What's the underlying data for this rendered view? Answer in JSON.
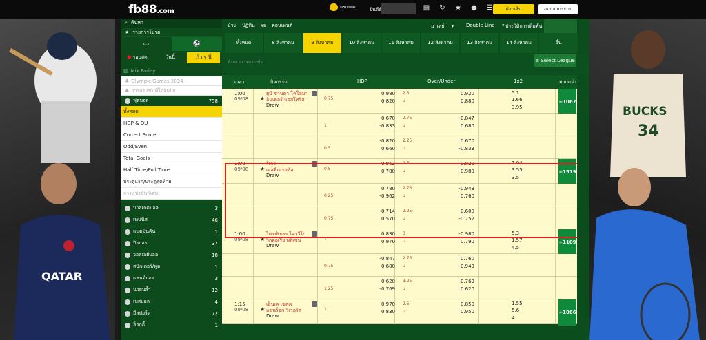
{
  "topbar": {
    "logo": "fb88",
    "logo_suffix": ".com",
    "msg_label": "แชทสด",
    "welcome": "ยินดีต้อนรับ",
    "deposit": "ฝากเงิน",
    "logout": "ออกจากระบบ"
  },
  "sidebar": {
    "search": "ค้นหา",
    "favorites": "รายการโปรด",
    "tabs": [
      "รอบสด",
      "วันนี้",
      "เร็ว ๆ นี้"
    ],
    "mix": "Mix Parlay",
    "olympic1": "Olympic Games 2024",
    "olympic2": "การแข่งขันที่โอลิมปิก",
    "soccer": {
      "label": "ฟุตบอล",
      "count": "758"
    },
    "submenu": [
      "ทั้งหมด",
      "HDP & OU",
      "Correct Score",
      "Odd/Even",
      "Total Goals",
      "Half Time/Full Time",
      "ประตูแรก/ประตูสุดท้าย",
      "การแข่งขันพิเศษ"
    ],
    "sports": [
      {
        "label": "บาสเกตบอล",
        "count": "3"
      },
      {
        "label": "เทนนิส",
        "count": "46"
      },
      {
        "label": "แบดมินตัน",
        "count": "1"
      },
      {
        "label": "ปิงปอง",
        "count": "37"
      },
      {
        "label": "วอลเลย์บอล",
        "count": "18"
      },
      {
        "label": "สนุ๊กเกอร์/พูล",
        "count": "1"
      },
      {
        "label": "แฮนด์บอล",
        "count": "3"
      },
      {
        "label": "นวยปล้ำ",
        "count": "12"
      },
      {
        "label": "เบสบอล",
        "count": "4"
      },
      {
        "label": "อีสปอร์ต",
        "count": "72"
      },
      {
        "label": "ฮ็อกกี้",
        "count": "1"
      }
    ]
  },
  "main": {
    "nav": [
      "บ้าน",
      "ปฏิทิน",
      "ผล",
      "คอนเทนต์"
    ],
    "nav_odds": "มาเลย์",
    "nav_line": "Double Line",
    "nav_history": "ประวัติการเดิมพัน",
    "days": [
      "ทั้งหมด",
      "8 สิงหาคม",
      "9 สิงหาคม",
      "10 สิงหาคม",
      "11 สิงหาคม",
      "12 สิงหาคม",
      "13 สิงหาคม",
      "14 สิงหาคม",
      "อื่น"
    ],
    "section_title": "ค้นหาการแข่งขัน",
    "select_league": "Select League",
    "headers": {
      "time": "เวลา",
      "event": "กิจกรรม",
      "hdp": "HDP",
      "ou": "Over/Under",
      "x12": "1x2",
      "more": "มากกว่า"
    }
  },
  "matches": [
    {
      "time": "1:00",
      "date": "09/08",
      "home": "ยูนี ซานตา โคโลมา",
      "away": "อินเตอร์ แอสโทริส",
      "draw": "Draw",
      "more": "+1067",
      "lines": [
        {
          "hdp": "0.75",
          "hdp_top": "0.980",
          "hdp_bot": "0.820",
          "ou": "2.5",
          "ou_top": "0.920",
          "ou_bot": "0.880",
          "x1": "5.1",
          "x2": "1.66",
          "x3": "3.95"
        },
        {
          "hdp": "1",
          "hdp_top": "0.670",
          "hdp_bot": "-0.833",
          "ou": "2.75",
          "ou_top": "-0.847",
          "ou_bot": "0.680"
        },
        {
          "hdp": "0.5",
          "hdp_top": "-0.820",
          "hdp_bot": "0.660",
          "ou": "2.25",
          "ou_top": "0.670",
          "ou_bot": "-0.833"
        }
      ]
    },
    {
      "time": "1:00",
      "date": "09/08",
      "home": "ริเกร",
      "away": "เอสพีเดรอซัล",
      "draw": "Draw",
      "more": "+1519",
      "lines": [
        {
          "hdp": "0.5",
          "hdp_top": "-0.962",
          "hdp_bot": "0.780",
          "ou": "2.5",
          "ou_top": "0.820",
          "ou_bot": "0.980",
          "x1": "2.04",
          "x2": "3.55",
          "x3": "3.5"
        },
        {
          "hdp": "0.25",
          "hdp_top": "0.780",
          "hdp_bot": "-0.962",
          "ou": "2.75",
          "ou_top": "-0.943",
          "ou_bot": "0.760"
        },
        {
          "hdp": "0.75",
          "hdp_top": "-0.714",
          "hdp_bot": "0.570",
          "ou": "2.25",
          "ou_top": "0.600",
          "ou_bot": "-0.752"
        }
      ]
    },
    {
      "time": "1:00",
      "date": "09/08",
      "home": "ไครฟ์เบรร ไครวีโก",
      "away": "วิกตอเรีย พลิเซน",
      "draw": "Draw",
      "more": "+1109",
      "lines": [
        {
          "hdp": "1",
          "hdp_top": "0.830",
          "hdp_bot": "0.970",
          "ou": "3",
          "ou_top": "-0.980",
          "ou_bot": "0.790",
          "x1": "5.3",
          "x2": "1.57",
          "x3": "4.5"
        },
        {
          "hdp": "0.75",
          "hdp_top": "-0.847",
          "hdp_bot": "0.680",
          "ou": "2.75",
          "ou_top": "0.760",
          "ou_bot": "-0.943"
        },
        {
          "hdp": "1.25",
          "hdp_top": "0.620",
          "hdp_bot": "-0.769",
          "ou": "3.25",
          "ou_top": "-0.769",
          "ou_bot": "0.620"
        }
      ]
    },
    {
      "time": "1:15",
      "date": "09/08",
      "home": "เอ็นเค เซลเจ",
      "away": "แซนร็อก วิเวอร์ส",
      "draw": "Draw",
      "more": "+1066",
      "lines": [
        {
          "hdp": "1",
          "hdp_top": "0.970",
          "hdp_bot": "0.830",
          "ou": "2.5",
          "ou_top": "0.850",
          "ou_bot": "0.950",
          "x1": "1.55",
          "x2": "5.6",
          "x3": "4"
        }
      ]
    }
  ],
  "colors": {
    "green": "#0b4d1d",
    "yellow": "#f5d400",
    "row": "#fefacb",
    "highlight": "#e02020"
  }
}
